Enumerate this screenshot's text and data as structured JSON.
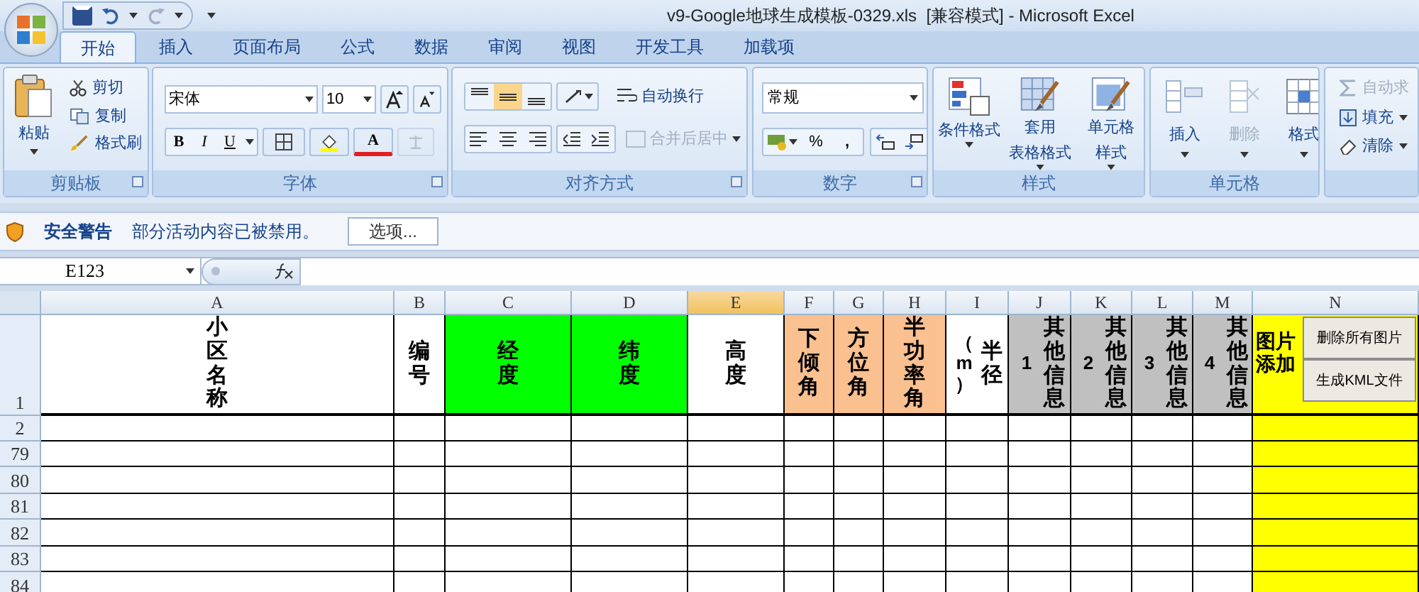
{
  "window": {
    "title": "v9-Google地球生成模板-0329.xls  [兼容模式] - Microsoft Excel"
  },
  "tabs": [
    {
      "label": "开始",
      "selected": true
    },
    {
      "label": "插入",
      "selected": false
    },
    {
      "label": "页面布局",
      "selected": false
    },
    {
      "label": "公式",
      "selected": false
    },
    {
      "label": "数据",
      "selected": false
    },
    {
      "label": "审阅",
      "selected": false
    },
    {
      "label": "视图",
      "selected": false
    },
    {
      "label": "开发工具",
      "selected": false
    },
    {
      "label": "加载项",
      "selected": false
    }
  ],
  "ribbon": {
    "clipboard": {
      "label": "剪贴板",
      "paste": "粘贴",
      "actions": [
        "剪切",
        "复制",
        "格式刷"
      ]
    },
    "font": {
      "label": "字体",
      "font_name": "宋体",
      "font_size": "10",
      "bold": "B",
      "italic": "I",
      "underline": "U",
      "font_color": "A"
    },
    "alignment": {
      "label": "对齐方式",
      "vertical_align": [
        {
          "selected": false
        },
        {
          "selected": true
        },
        {
          "selected": false
        }
      ],
      "wrap_text": {
        "label": "自动换行",
        "disabled": false
      },
      "merge_center": {
        "label": "合并后居中",
        "disabled": true
      }
    },
    "number": {
      "label": "数字",
      "format": "常规",
      "percent": "%",
      "comma": ","
    },
    "styles": {
      "label": "样式",
      "buttons": [
        {
          "lines": [
            "条件格式"
          ]
        },
        {
          "lines": [
            "套用",
            "表格格式"
          ]
        },
        {
          "lines": [
            "单元格",
            "样式"
          ]
        }
      ]
    },
    "cells": {
      "label": "单元格",
      "buttons": [
        {
          "label": "插入",
          "disabled": false
        },
        {
          "label": "删除",
          "disabled": true
        },
        {
          "label": "格式",
          "disabled": false
        }
      ]
    },
    "editing": {
      "items": [
        {
          "label": "自动求",
          "disabled": true
        },
        {
          "label": "填充",
          "disabled": false
        },
        {
          "label": "清除",
          "disabled": false
        }
      ]
    }
  },
  "security_bar": {
    "title": "安全警告",
    "message": "部分活动内容已被禁用。",
    "button": "选项..."
  },
  "formula_bar": {
    "name_box": "E123"
  },
  "sheet": {
    "columns": [
      {
        "letter": "A",
        "selected": false,
        "color": "#ffffff"
      },
      {
        "letter": "B",
        "selected": false,
        "color": "#ffffff"
      },
      {
        "letter": "C",
        "selected": false,
        "color": "#ffffff"
      },
      {
        "letter": "D",
        "selected": false,
        "color": "#ffffff"
      },
      {
        "letter": "E",
        "selected": true,
        "color": "#ffffff"
      },
      {
        "letter": "F",
        "selected": false,
        "color": "#ffffff"
      },
      {
        "letter": "G",
        "selected": false,
        "color": "#ffffff"
      },
      {
        "letter": "H",
        "selected": false,
        "color": "#ffffff"
      },
      {
        "letter": "I",
        "selected": false,
        "color": "#ffffff"
      },
      {
        "letter": "J",
        "selected": false,
        "color": "#ffffff"
      },
      {
        "letter": "K",
        "selected": false,
        "color": "#ffffff"
      },
      {
        "letter": "L",
        "selected": false,
        "color": "#ffffff"
      },
      {
        "letter": "M",
        "selected": false,
        "color": "#ffffff"
      },
      {
        "letter": "N",
        "selected": false,
        "color": "#ffff00"
      }
    ],
    "header_cells": [
      {
        "label": "小区名称",
        "color": "#ffffff"
      },
      {
        "label": "编号",
        "color": "#ffffff"
      },
      {
        "label": "经度",
        "color": "#00ff00"
      },
      {
        "label": "纬度",
        "color": "#00ff00"
      },
      {
        "label": "高度",
        "color": "#ffffff"
      },
      {
        "label": "下倾角",
        "color": "#fac090"
      },
      {
        "label": "方位角",
        "color": "#fac090"
      },
      {
        "label": "半功率角",
        "color": "#fac090"
      },
      {
        "label": "半径",
        "suffix": "（m）",
        "color": "#ffffff"
      },
      {
        "label": "其他信息",
        "suffix": "1",
        "color": "#c0c0c0"
      },
      {
        "label": "其他信息",
        "suffix": "2",
        "color": "#c0c0c0"
      },
      {
        "label": "其他信息",
        "suffix": "3",
        "color": "#c0c0c0"
      },
      {
        "label": "其他信息",
        "suffix": "4",
        "color": "#c0c0c0"
      },
      {
        "label": "图片添加",
        "color": "#ffff00",
        "buttons": [
          "删除所有图片",
          "生成KML文件"
        ]
      }
    ],
    "row_numbers": [
      "1",
      "2",
      "79",
      "80",
      "81",
      "82",
      "83",
      "84"
    ]
  }
}
